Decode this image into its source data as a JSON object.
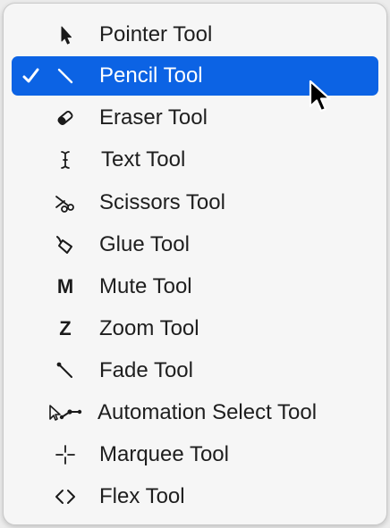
{
  "menu": {
    "items": [
      {
        "label": "Pointer Tool",
        "icon": "pointer-icon",
        "selected": false
      },
      {
        "label": "Pencil Tool",
        "icon": "pencil-icon",
        "selected": true
      },
      {
        "label": "Eraser Tool",
        "icon": "eraser-icon",
        "selected": false
      },
      {
        "label": "Text Tool",
        "icon": "text-cursor-icon",
        "selected": false
      },
      {
        "label": "Scissors Tool",
        "icon": "scissors-icon",
        "selected": false
      },
      {
        "label": "Glue Tool",
        "icon": "glue-icon",
        "selected": false
      },
      {
        "label": "Mute Tool",
        "icon": "mute-icon",
        "icon_text": "M",
        "selected": false
      },
      {
        "label": "Zoom Tool",
        "icon": "zoom-icon",
        "icon_text": "Z",
        "selected": false
      },
      {
        "label": "Fade Tool",
        "icon": "fade-icon",
        "selected": false
      },
      {
        "label": "Automation Select Tool",
        "icon": "automation-select-icon",
        "selected": false
      },
      {
        "label": "Marquee Tool",
        "icon": "marquee-icon",
        "selected": false
      },
      {
        "label": "Flex Tool",
        "icon": "flex-icon",
        "selected": false
      }
    ]
  },
  "colors": {
    "highlight": "#0c63e4",
    "menu_background": "#f6f6f6",
    "text": "#1e1e1e"
  }
}
